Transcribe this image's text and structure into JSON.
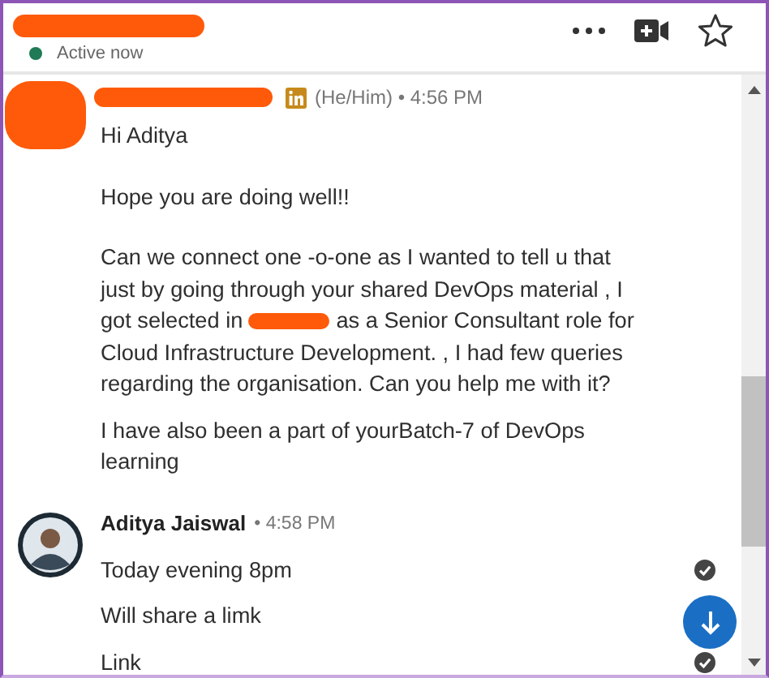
{
  "header": {
    "status": "Active now",
    "online": true
  },
  "groups": [
    {
      "redacted": true,
      "linkedin": true,
      "meta": "(He/Him) • 4:56 PM",
      "messages": [
        {
          "kind": "paragraph",
          "text": "Hi Aditya"
        },
        {
          "kind": "paragraph",
          "text": "Hope you are doing well!!"
        },
        {
          "kind": "split",
          "before": "Can we connect one -o-one as I wanted to tell u that just by going through your shared DevOps material , I got selected in",
          "after": "as a Senior Consultant role for Cloud Infrastructure Development. , I had few queries regarding the organisation. Can you help me with it?"
        },
        {
          "kind": "bubble",
          "text": "I have also been a part of yourBatch-7 of DevOps learning"
        }
      ]
    },
    {
      "redacted": false,
      "name": "Aditya Jaiswal",
      "meta": "• 4:58 PM",
      "messages": [
        {
          "kind": "bubble",
          "text": "Today evening 8pm",
          "read": true
        },
        {
          "kind": "bubble",
          "text": "Will share a limk"
        },
        {
          "kind": "bubble",
          "text": "Link",
          "read": true
        }
      ]
    }
  ]
}
